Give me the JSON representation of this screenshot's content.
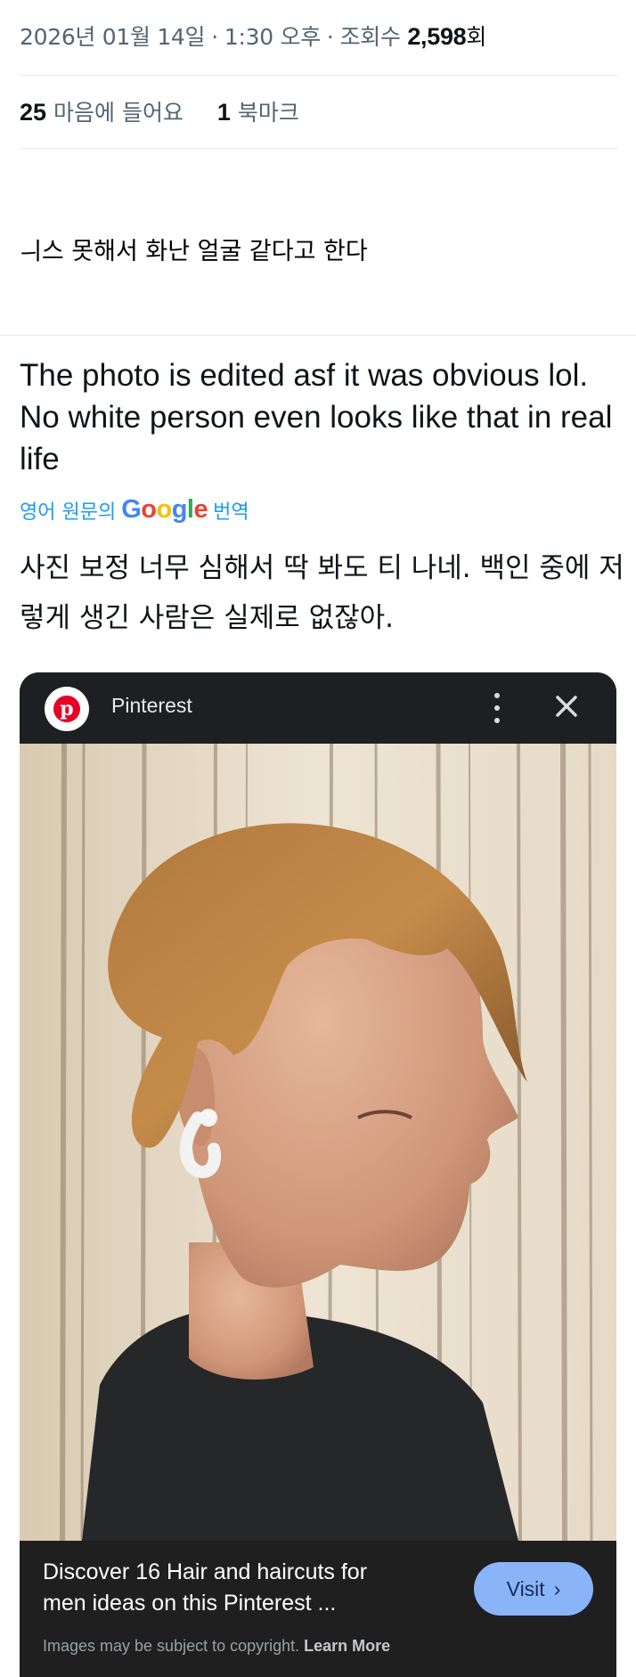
{
  "tweet_meta": {
    "date": "2026년 01월 14일",
    "time": "1:30 오후",
    "views_label": "조회수",
    "views_count": "2,598",
    "views_unit": "회",
    "separator": "·"
  },
  "stats": {
    "likes_count": "25",
    "likes_label": "마음에 들어요",
    "bookmarks_count": "1",
    "bookmarks_label": "북마크"
  },
  "quote_text": "ㅢ스 못해서 화난 얼굴 같다고 한다",
  "reply": {
    "english_text": "The photo is edited asf it was obvious lol. No white person even looks like that in real life",
    "translate_prefix": "영어 원문의",
    "translate_brand": {
      "G": "G",
      "o1": "o",
      "o2": "o",
      "g": "g",
      "l": "l",
      "e": "e"
    },
    "translate_suffix": "번역",
    "korean_text": "사진 보정 너무 심해서 딱 봐도 티 나네. 백인 중에 저렇게 생긴 사람은 실제로 없잖아."
  },
  "pinterest_card": {
    "app_title": "Pinterest",
    "logo_letter": "p",
    "footer_title": "Discover 16 Hair and haircuts for men ideas on this Pinterest ...",
    "visit_label": "Visit",
    "visit_chevron": "›",
    "copyright_note": "Images may be subject to copyright.",
    "learn_more": "Learn More"
  },
  "colors": {
    "muted_text": "#536471",
    "link_blue": "#1d9bf0",
    "card_bg": "#1f1f1f",
    "visit_button": "#8ab4f8",
    "pinterest_red": "#e60023"
  },
  "icons": [
    "pinterest-logo-icon",
    "more-vert-icon",
    "close-icon",
    "chevron-right-icon"
  ]
}
